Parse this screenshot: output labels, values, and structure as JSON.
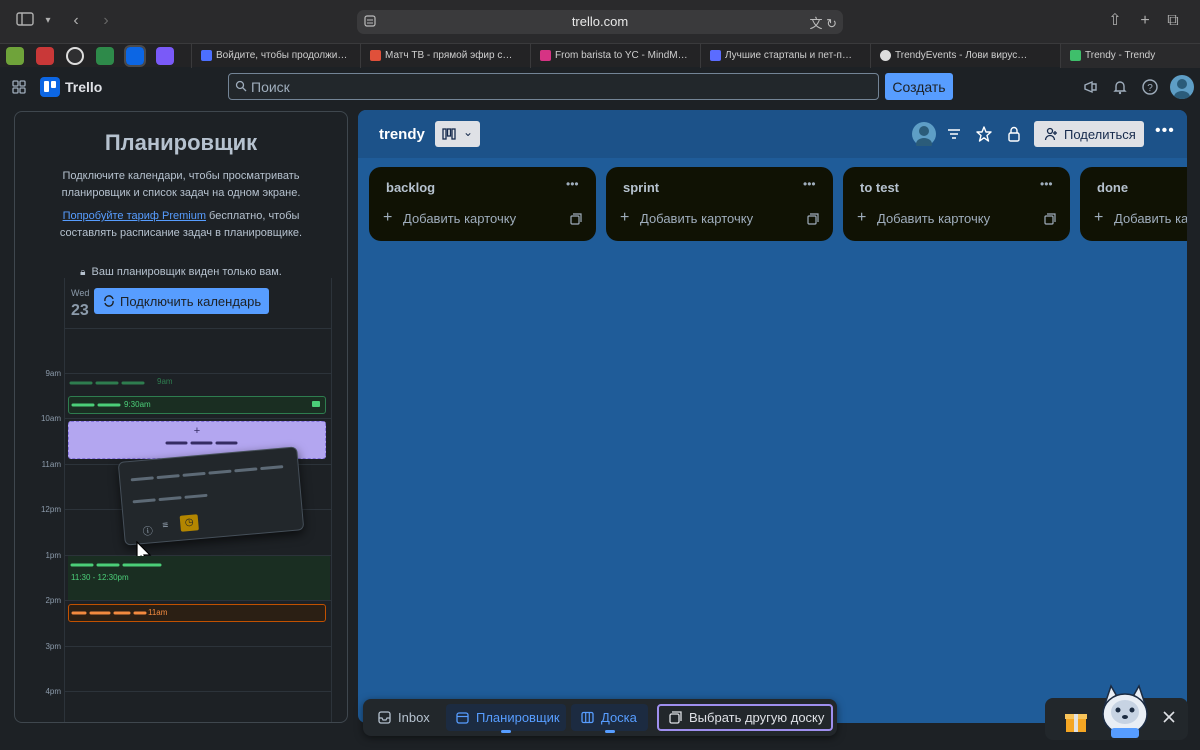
{
  "browser": {
    "url": "trello.com",
    "tabs": [
      {
        "label": "Войдите, чтобы продолжи…",
        "color": "#4c6fff"
      },
      {
        "label": "Матч ТВ - прямой эфир с…",
        "color": "#e0503a"
      },
      {
        "label": "From barista to YC - MindM…",
        "color": "#d63384"
      },
      {
        "label": "Лучшие стартапы и пет-п…",
        "color": "#5b6cff"
      },
      {
        "label": "TrendyEvents - Лови вирус…",
        "color": "#dddddd"
      },
      {
        "label": "Trendy - Trendy",
        "color": "#3fbf6b"
      }
    ]
  },
  "header": {
    "logo_text": "Trello",
    "search_placeholder": "Поиск",
    "create_label": "Создать"
  },
  "planner": {
    "title": "Планировщик",
    "description": "Подключите календари, чтобы просматривать планировщик и список задач на одном экране.",
    "premium_link": "Попробуйте тариф Premium",
    "premium_rest": " бесплатно, чтобы составлять расписание задач в планировщике.",
    "privacy": "Ваш планировщик виден только вам.",
    "connect_label": "Подключить календарь",
    "day": "Wed",
    "date": "23",
    "hours": [
      "9am",
      "10am",
      "11am",
      "12pm",
      "1pm",
      "2pm",
      "3pm",
      "4pm"
    ],
    "events": [
      "9am",
      "9:30am",
      "11:30 - 12:30pm",
      "11am"
    ]
  },
  "board": {
    "title": "trendy",
    "share_label": "Поделиться",
    "add_card_label": "Добавить карточку",
    "lists": [
      "backlog",
      "sprint",
      "to test",
      "done"
    ]
  },
  "switcher": {
    "inbox": "Inbox",
    "planner": "Планировщик",
    "board": "Доска",
    "choose": "Выбрать другую доску"
  }
}
